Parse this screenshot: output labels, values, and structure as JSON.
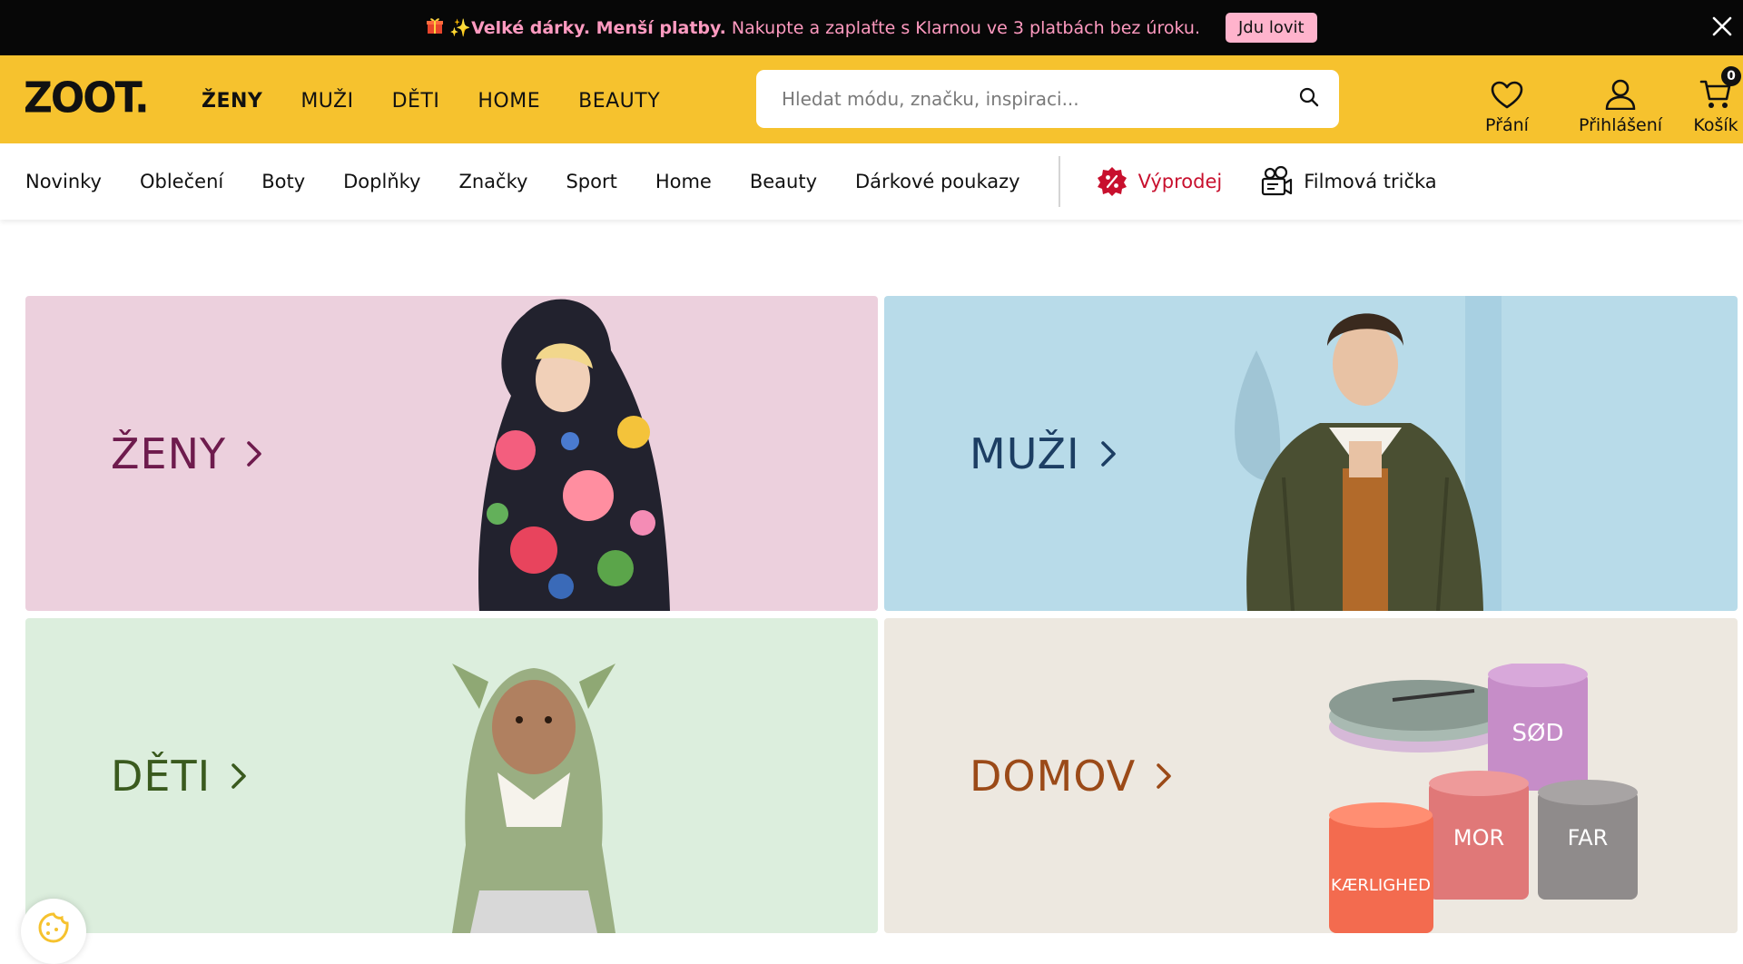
{
  "promo": {
    "gift_icon": "gift-icon",
    "sparkle": "✨",
    "headline": "Velké dárky. Menší platby.",
    "body": "Nakupte a zaplaťte s Klarnou ve 3 platbách bez úroku.",
    "cta": "Jdu lovit"
  },
  "header": {
    "logo": "ZOOT.",
    "gender_nav": [
      "ŽENY",
      "MUŽI",
      "DĚTI",
      "HOME",
      "BEAUTY"
    ],
    "search_placeholder": "Hledat módu, značku, inspiraci...",
    "wishlist_label": "Přání",
    "login_label": "Přihlášení",
    "cart_label": "Košík",
    "cart_count": "0"
  },
  "categories": [
    "Novinky",
    "Oblečení",
    "Boty",
    "Doplňky",
    "Značky",
    "Sport",
    "Home",
    "Beauty",
    "Dárkové poukazy"
  ],
  "special_links": {
    "sale": "Výprodej",
    "movie_tees": "Filmová trička"
  },
  "tiles": {
    "women": "ŽENY",
    "men": "MUŽI",
    "kids": "DĚTI",
    "home": "DOMOV"
  },
  "mug_words": [
    "SØD",
    "MOR",
    "FAR",
    "KÆRLIGHED"
  ],
  "colors": {
    "brand_yellow": "#f6c22e",
    "sale_red": "#c8102e",
    "promo_pink": "#ff9ac0"
  }
}
